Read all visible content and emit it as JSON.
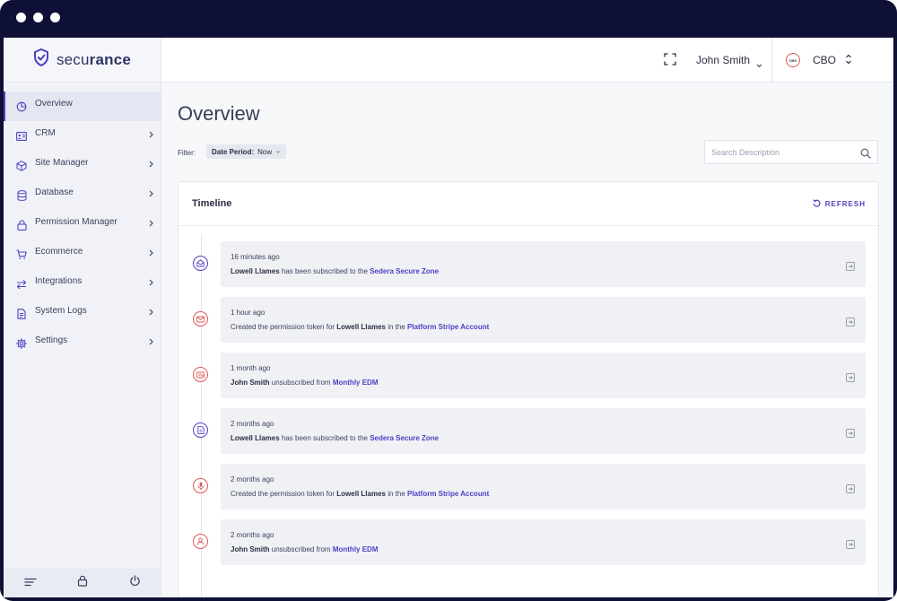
{
  "brand": {
    "part1": "secu",
    "part2": "rance"
  },
  "colors": {
    "accent": "#4d3fc4",
    "frame": "#0f1035",
    "danger": "#e05656"
  },
  "sidebar": {
    "items": [
      {
        "label": "Overview",
        "icon": "pie-chart-icon",
        "active": true
      },
      {
        "label": "CRM",
        "icon": "id-card-icon"
      },
      {
        "label": "Site Manager",
        "icon": "cube-icon"
      },
      {
        "label": "Database",
        "icon": "database-icon"
      },
      {
        "label": "Permission Manager",
        "icon": "lock-icon"
      },
      {
        "label": "Ecommerce",
        "icon": "cart-icon"
      },
      {
        "label": "Integrations",
        "icon": "arrows-icon"
      },
      {
        "label": "System Logs",
        "icon": "document-icon"
      },
      {
        "label": "Settings",
        "icon": "gear-icon"
      }
    ],
    "footer": [
      "menu-icon",
      "lock-icon",
      "power-icon"
    ]
  },
  "header": {
    "user_name": "John Smith",
    "org_badge": "CBO",
    "org_name": "CBO"
  },
  "main": {
    "title": "Overview",
    "filter_label": "Filter:",
    "filter_key": "Date Period:",
    "filter_value": "Now",
    "search_placeholder": "Search Description"
  },
  "timeline": {
    "title": "Timeline",
    "refresh_label": "REFRESH",
    "items": [
      {
        "time": "16 minutes ago",
        "icon": "mail-open-icon",
        "color": "#4d3fc4",
        "pre": "",
        "who": "Lowell Llames",
        "mid": " has been subscribed to the ",
        "link": "Sedera Secure Zone"
      },
      {
        "time": "1 hour ago",
        "icon": "envelope-icon",
        "color": "#e05656",
        "pre": "Created the permission token for ",
        "who": "Lowell Llames",
        "mid": " in the ",
        "link": "Platform Stripe Account"
      },
      {
        "time": "1 month ago",
        "icon": "ticket-icon",
        "color": "#e05656",
        "pre": "",
        "who": "John Smith",
        "mid": " unsubscribed from ",
        "link": "Monthly EDM"
      },
      {
        "time": "2 months ago",
        "icon": "file-icon",
        "color": "#4d3fc4",
        "pre": "",
        "who": "Lowell Llames",
        "mid": " has been subscribed to the ",
        "link": "Sedera Secure Zone"
      },
      {
        "time": "2 months ago",
        "icon": "microphone-icon",
        "color": "#e05656",
        "pre": "Created the permission token for ",
        "who": "Lowell Llames",
        "mid": " in the ",
        "link": "Platform Stripe Account"
      },
      {
        "time": "2 months ago",
        "icon": "user-icon",
        "color": "#e05656",
        "pre": "",
        "who": "John Smith",
        "mid": " unsubscribed from ",
        "link": "Monthly EDM"
      }
    ]
  }
}
